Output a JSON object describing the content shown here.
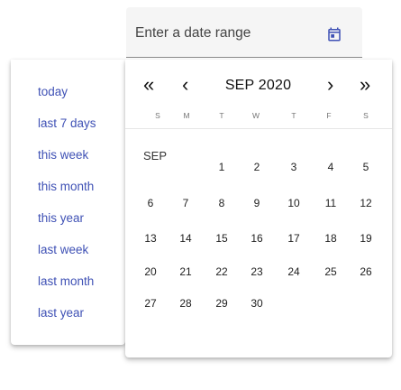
{
  "range_field": {
    "placeholder": "Enter a date range",
    "toggle_icon": "calendar-icon",
    "accent_color": "#3f51b5"
  },
  "presets": [
    "today",
    "last 7 days",
    "this week",
    "this month",
    "this year",
    "last week",
    "last month",
    "last year"
  ],
  "calendar": {
    "period_label": "SEP 2020",
    "month_label": "SEP",
    "nav": {
      "prev_year": "«",
      "prev_month": "‹",
      "next_month": "›",
      "next_year": "»"
    },
    "weekdays": [
      "S",
      "M",
      "T",
      "W",
      "T",
      "F",
      "S"
    ],
    "weeks": [
      [
        "",
        "",
        "1",
        "2",
        "3",
        "4",
        "5"
      ],
      [
        "6",
        "7",
        "8",
        "9",
        "10",
        "11",
        "12"
      ],
      [
        "13",
        "14",
        "15",
        "16",
        "17",
        "18",
        "19"
      ],
      [
        "20",
        "21",
        "22",
        "23",
        "24",
        "25",
        "26"
      ],
      [
        "27",
        "28",
        "29",
        "30",
        "",
        "",
        ""
      ]
    ]
  }
}
